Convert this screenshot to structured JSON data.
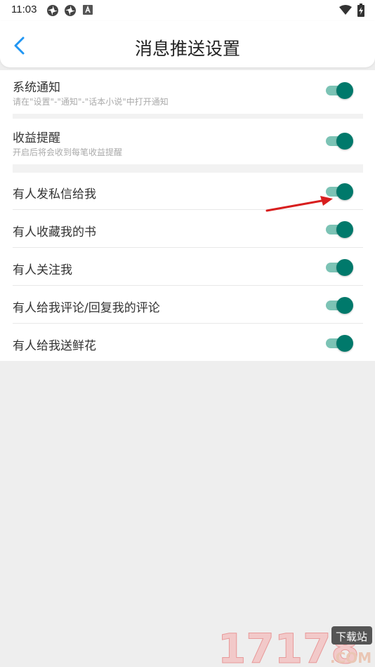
{
  "status_bar": {
    "time": "11:03",
    "icons": [
      "pinwheel-icon",
      "pinwheel-icon",
      "a-box-icon",
      "wifi-icon",
      "battery-charging-icon"
    ]
  },
  "header": {
    "title": "消息推送设置",
    "back_icon": "chevron-left-icon"
  },
  "settings": [
    {
      "title": "系统通知",
      "subtitle": "请在\"设置\"-\"通知\"-\"话本小说\"中打开通知",
      "enabled": true
    },
    {
      "title": "收益提醒",
      "subtitle": "开启后将会收到每笔收益提醒",
      "enabled": true
    },
    {
      "title": "有人发私信给我",
      "enabled": true
    },
    {
      "title": "有人收藏我的书",
      "enabled": true
    },
    {
      "title": "有人关注我",
      "enabled": true
    },
    {
      "title": "有人给我评论/回复我的评论",
      "enabled": true
    },
    {
      "title": "有人给我送鲜花",
      "enabled": true
    }
  ],
  "colors": {
    "accent": "#00796b",
    "track": "#7cc3b5",
    "back": "#2196f3",
    "arrow": "#d81e1e"
  },
  "watermark": {
    "main": "17178",
    "badge": "下载站",
    "domain": ".COM"
  }
}
